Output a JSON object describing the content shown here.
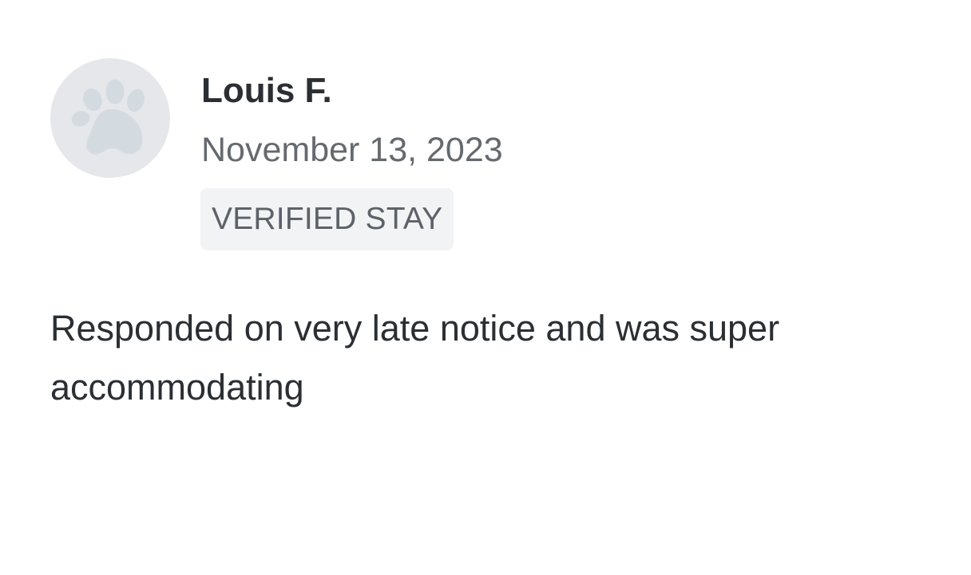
{
  "review": {
    "reviewer_name": "Louis F.",
    "date": "November 13, 2023",
    "badge": "VERIFIED STAY",
    "text": "Responded on very late notice and was super accommodating",
    "avatar_icon": "paw-icon"
  },
  "colors": {
    "avatar_background": "#e6e7ea",
    "avatar_icon": "#d3dbe1",
    "badge_background": "#f2f3f5",
    "name_text": "#2b2f33",
    "secondary_text": "#656a6f"
  }
}
